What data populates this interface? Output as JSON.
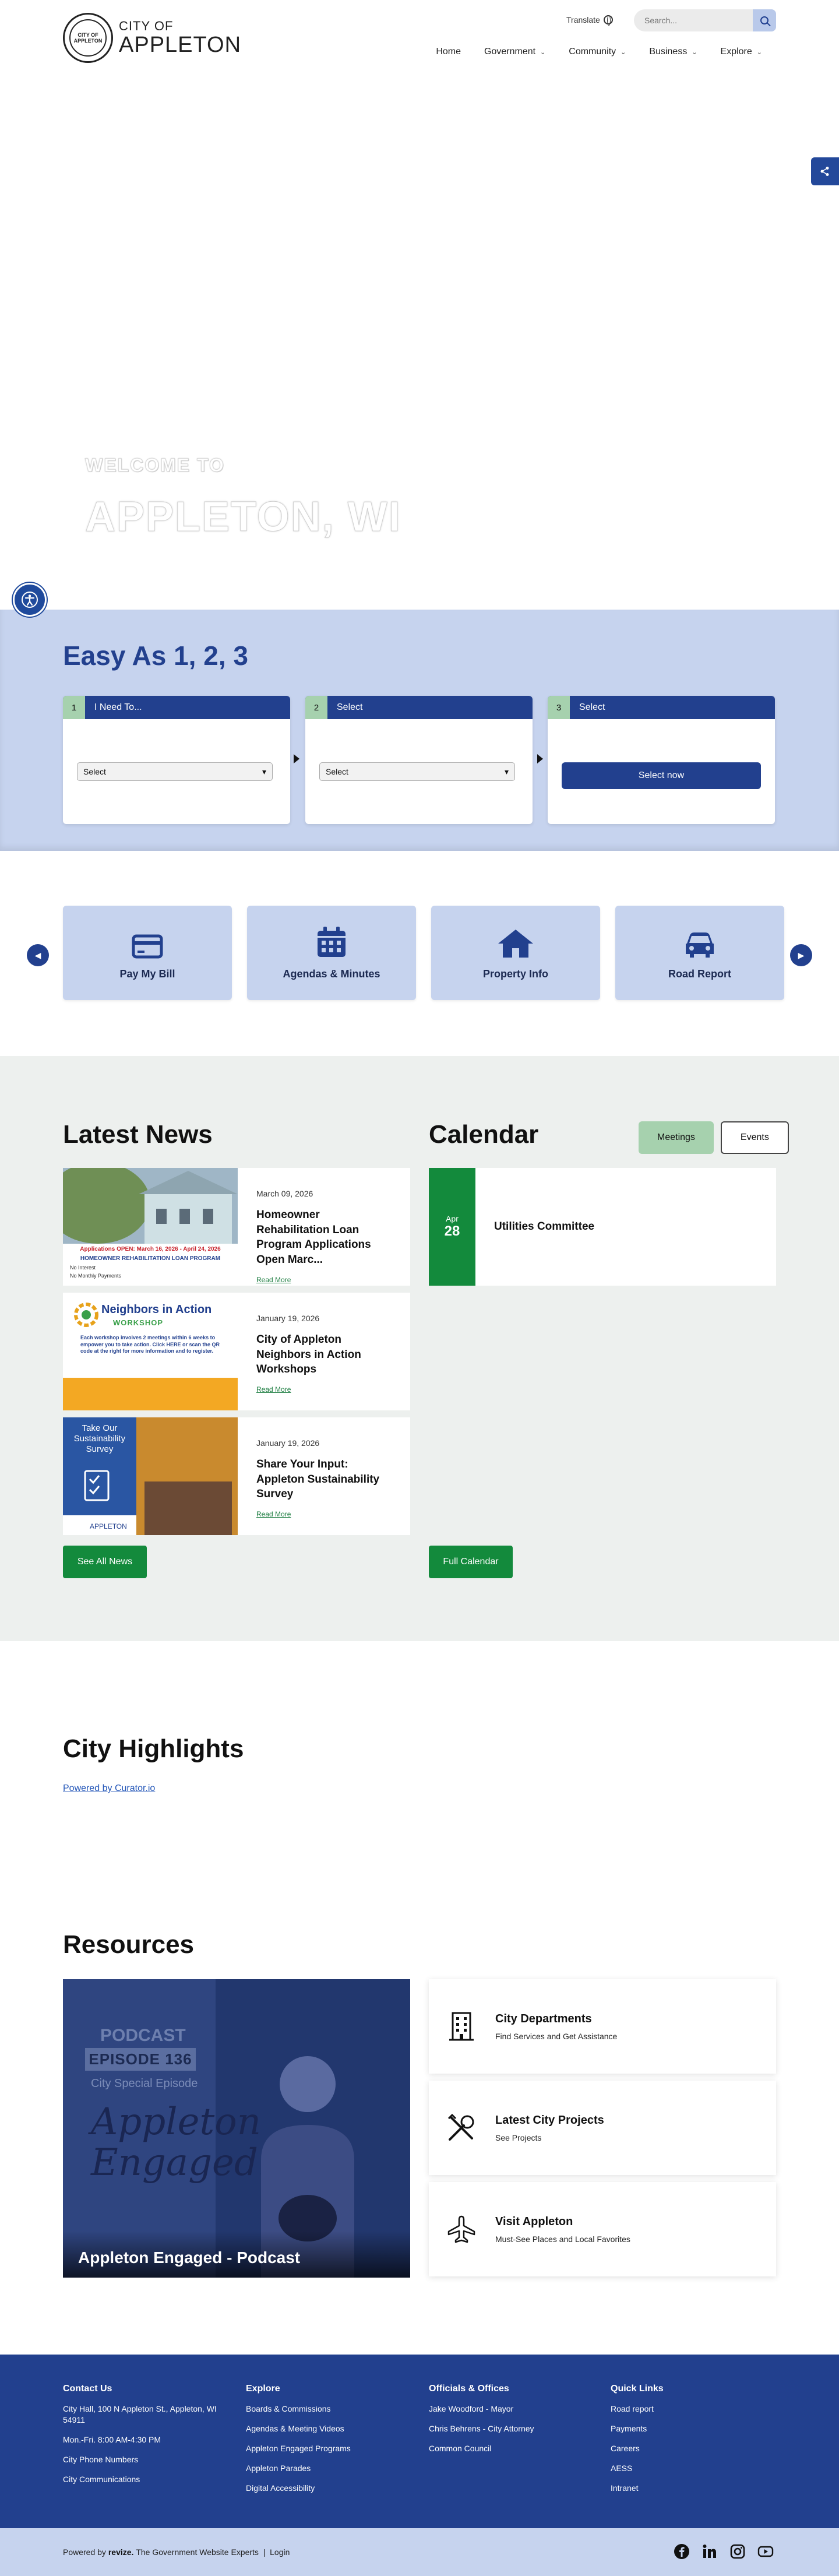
{
  "header": {
    "logo_small": "CITY OF",
    "logo_big": "APPLETON",
    "seal_text": "CITY OF APPLETON",
    "translate_label": "Translate",
    "search_placeholder": "Search...",
    "nav": [
      {
        "label": "Home",
        "has_menu": false
      },
      {
        "label": "Government",
        "has_menu": true
      },
      {
        "label": "Community",
        "has_menu": true
      },
      {
        "label": "Business",
        "has_menu": true
      },
      {
        "label": "Explore",
        "has_menu": true
      }
    ]
  },
  "hero": {
    "welcome": "WELCOME TO",
    "title": "APPLETON, WI"
  },
  "easy": {
    "title": "Easy As 1, 2, 3",
    "steps": [
      {
        "num": "1",
        "label": "I Need To...",
        "control": "Select"
      },
      {
        "num": "2",
        "label": "Select",
        "control": "Select"
      },
      {
        "num": "3",
        "label": "Select",
        "control": "Select now"
      }
    ]
  },
  "quick_links": [
    {
      "label": "Pay My Bill",
      "icon": "credit-card-icon"
    },
    {
      "label": "Agendas & Minutes",
      "icon": "calendar-icon"
    },
    {
      "label": "Property Info",
      "icon": "house-icon"
    },
    {
      "label": "Road Report",
      "icon": "car-icon"
    }
  ],
  "news": {
    "title": "Latest News",
    "read_more": "Read More",
    "see_all": "See All News",
    "items": [
      {
        "date": "March 09, 2026",
        "title": "Homeowner Rehabilitation Loan Program Applications Open Marc...",
        "img_banner": "Applications OPEN: March 16, 2026 - April 24, 2026",
        "img_sub": "HOMEOWNER REHABILITATION LOAN PROGRAM",
        "img_list": [
          "No Interest",
          "No Monthly Payments"
        ]
      },
      {
        "date": "January 19, 2026",
        "title": "City of Appleton Neighbors in Action Workshops",
        "img_head": "Neighbors in Action",
        "img_head2": "WORKSHOP",
        "img_body": "Each workshop involves 2 meetings within 6 weeks to empower you to take action. Click HERE or scan the QR code at the right for more information and to register."
      },
      {
        "date": "January 19, 2026",
        "title": "Share Your Input: Appleton Sustainability Survey",
        "img_text": "Take Our Sustainability Survey",
        "img_logo": "APPLETON"
      }
    ]
  },
  "calendar": {
    "title": "Calendar",
    "tabs": [
      "Meetings",
      "Events"
    ],
    "full_label": "Full Calendar",
    "events": [
      {
        "month": "Apr",
        "day": "28",
        "name": "Utilities Committee"
      }
    ]
  },
  "highlights": {
    "title": "City Highlights",
    "powered": "Powered by Curator.io"
  },
  "resources": {
    "title": "Resources",
    "podcast": {
      "word": "PODCAST",
      "episode": "EPISODE 136",
      "sub": "City Special Episode",
      "script": "Appleton Engaged!",
      "caption": "Appleton Engaged - Podcast"
    },
    "cards": [
      {
        "title": "City Departments",
        "sub": "Find Services and Get Assistance",
        "icon": "building-icon"
      },
      {
        "title": "Latest City Projects",
        "sub": "See Projects",
        "icon": "tools-icon"
      },
      {
        "title": "Visit Appleton",
        "sub": "Must-See Places and Local Favorites",
        "icon": "airplane-icon"
      }
    ]
  },
  "footer": {
    "columns": [
      {
        "title": "Contact Us",
        "links": [
          "City Hall, 100 N Appleton St., Appleton, WI 54911",
          "Mon.-Fri. 8:00 AM-4:30 PM",
          "City Phone Numbers",
          "City Communications"
        ]
      },
      {
        "title": "Explore",
        "links": [
          "Boards & Commissions",
          "Agendas & Meeting Videos",
          "Appleton Engaged Programs",
          "Appleton Parades",
          "Digital Accessibility"
        ]
      },
      {
        "title": "Officials & Offices",
        "links": [
          "Jake Woodford - Mayor",
          "Chris Behrens - City Attorney",
          "Common Council"
        ]
      },
      {
        "title": "Quick Links",
        "links": [
          "Road report",
          "Payments",
          "Careers",
          "AESS",
          "Intranet"
        ]
      }
    ],
    "powered_prefix": "Powered by",
    "powered_brand": "revize.",
    "powered_suffix": "The Government Website Experts",
    "separator": "|",
    "login": "Login"
  },
  "colors": {
    "primary_blue": "#22408e",
    "light_blue": "#c6d3ee",
    "green": "#138a3c",
    "light_green": "#a6d1ae"
  }
}
